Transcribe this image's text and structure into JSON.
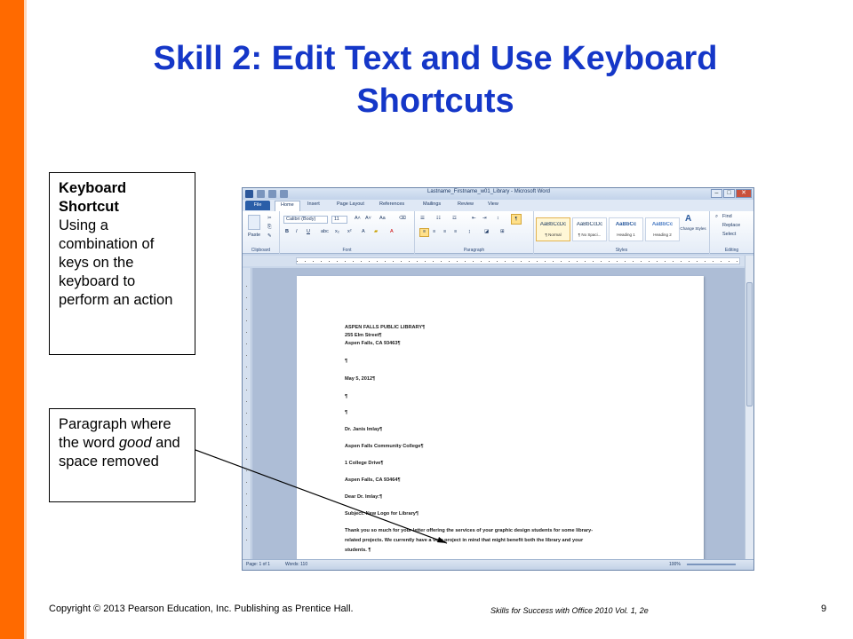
{
  "slide": {
    "title": "Skill 2: Edit Text and Use Keyboard Shortcuts",
    "callout_keyboard": {
      "heading": "Keyboard Shortcut",
      "body": "Using a combination of keys on the keyboard to perform an action"
    },
    "callout_paragraph": {
      "text_before": "Paragraph where the word ",
      "emphasis": "good",
      "text_after": " and space removed"
    },
    "footer_copyright": "Copyright © 2013 Pearson Education, Inc. Publishing as Prentice Hall.",
    "footer_book": "Skills for Success with Office 2010 Vol. 1, 2e",
    "page_number": "9",
    "accent_color": "#ff6a00",
    "title_color": "#1537c8"
  },
  "word": {
    "window_title": "Lastname_Firstname_w01_Library - Microsoft Word",
    "tabs": {
      "file": "File",
      "home": "Home",
      "insert": "Insert",
      "page_layout": "Page Layout",
      "references": "References",
      "mailings": "Mailings",
      "review": "Review",
      "view": "View"
    },
    "ribbon": {
      "paste": "Paste",
      "font_name": "Calibri (Body)",
      "font_size": "11",
      "groups": {
        "clipboard": "Clipboard",
        "font": "Font",
        "paragraph": "Paragraph",
        "styles": "Styles",
        "editing": "Editing"
      },
      "styles": [
        {
          "sample": "AaBbCcDc",
          "name": "¶ Normal"
        },
        {
          "sample": "AaBbCcDc",
          "name": "¶ No Spaci..."
        },
        {
          "sample": "AaBbCc",
          "name": "Heading 1"
        },
        {
          "sample": "AaBbCc",
          "name": "Heading 2"
        }
      ],
      "change_styles": "Change Styles",
      "find": "Find",
      "replace": "Replace",
      "select": "Select"
    },
    "document": {
      "lines": [
        "ASPEN FALLS PUBLIC LIBRARY¶",
        "255 Elm Street¶",
        "Aspen Falls, CA 93463¶",
        "¶",
        "May 5, 2012¶",
        "¶",
        "¶",
        "Dr. Janis Imlay¶",
        "Aspen Falls Community College¶",
        "1 College Drive¶",
        "Aspen Falls, CA 93464¶",
        "Dear Dr. Imlay:¶",
        "Subject: New Logo for Library¶",
        "Thank you so much for your letter offering the services of your graphic design students for some library-",
        "related projects. We currently have a very project in mind that might benefit both the library and your",
        "students. ¶"
      ]
    },
    "status": {
      "page": "Page: 1 of 1",
      "words": "Words: 110",
      "zoom": "100%"
    }
  }
}
